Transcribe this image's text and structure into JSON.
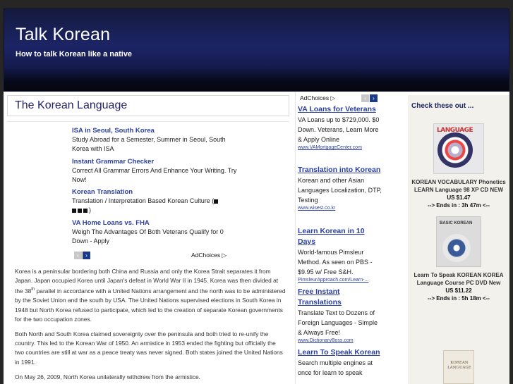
{
  "site": {
    "title": "Talk Korean",
    "tagline": "How to talk Korean like a native"
  },
  "post": {
    "title": "The Korean Language"
  },
  "inline_ads": {
    "items": [
      {
        "title": "ISA in Seoul, South Korea",
        "desc": "Study Abroad for a Semester, Summer in Seoul, South Korea with ISA"
      },
      {
        "title": "Instant Grammar Checker",
        "desc": "Correct All Grammar Errors And Enhance Your Writing. Try Now!"
      },
      {
        "title": "Korean Translation",
        "desc": "Translation / Interpretation Based Korean Culture ("
      },
      {
        "title": "VA Home Loans vs. FHA",
        "desc": "Weigh The Advantages Of Both Veterans Qualify for 0 Down - Apply"
      }
    ],
    "adchoices": "AdChoices",
    "prev": "‹",
    "next": "›",
    "end_paren": ")"
  },
  "article": {
    "p1_a": "Korea is a peninsular bordering both China and Russia and only the Korea Strait separates it from Japan.  Japan occupied Korea until Japan's defeat in World War II in 1945.  Korea was then divided at the 38",
    "p1_sup": "th",
    "p1_b": " parallel in accordance with a United Nations arrangement and the north was to be administered by the Soviet Union and the south by USA. The United Nations supervised elections in South Korea in 1948 but North Korea refused to participate, which led to the creation of separate Korean governments for the two occupation zones.",
    "p2": "Both North and South Korea claimed sovereignty over the peninsula and both tried to re-unify the country.  This led to the Korean War of 1950.  An armistice in 1953 ended the fighting but officially the two countries are still at war as a peace treaty was never signed. Both states joined the United Nations in 1991.",
    "p3": "On May 26, 2009, North Korea unilaterally withdrew from the armistice."
  },
  "mid_ads": {
    "adchoices": "AdChoices",
    "prev": "‹",
    "next": "›",
    "items": [
      {
        "title": "VA Loans for Veterans",
        "desc": "VA Loans up to $729,000. $0 Down. Veterans, Learn More & Apply Online",
        "url": "www.VAMortgageCenter.com"
      },
      {
        "title": "Translation into Korean",
        "desc": "Korean and other Asian Languages Localization, DTP, Testing",
        "url": "www.wisest.co.kr"
      },
      {
        "title": "Learn Korean in 10 Days",
        "desc": "World-famous Pimsleur Method. As seen on PBS - $9.95 w/ Free S&H.",
        "url": "PimsleurApproach.com/Learn-..."
      },
      {
        "title": "Free Instant Translations",
        "desc": "Translate Text to Dozens of Foreign Languages - Simple & Always Free!",
        "url": "www.DictionaryBoss.com"
      },
      {
        "title": "Learn To Speak Korean",
        "desc": "Search multiple engines at once for learn to speak",
        "url": ""
      }
    ]
  },
  "sidebar": {
    "heading": "Check these out ...",
    "products": [
      {
        "title": "KOREAN VOCABULARY Phonetics LEARN Language 98 XP CD NEW",
        "price": "US $1.47",
        "ends": "--> Ends in : 3h 47m <--",
        "art_label": "LANGUAGE"
      },
      {
        "title": "Learn To Speak KOREAN KOREA Language Course PC DVD New",
        "price": "US $11.22",
        "ends": "--> Ends in : 5h 18m <--",
        "art_label": "BASIC KOREAN"
      },
      {
        "title": "",
        "price": "",
        "ends": "",
        "art_label": "KOREAN LANGUAGE"
      }
    ]
  }
}
